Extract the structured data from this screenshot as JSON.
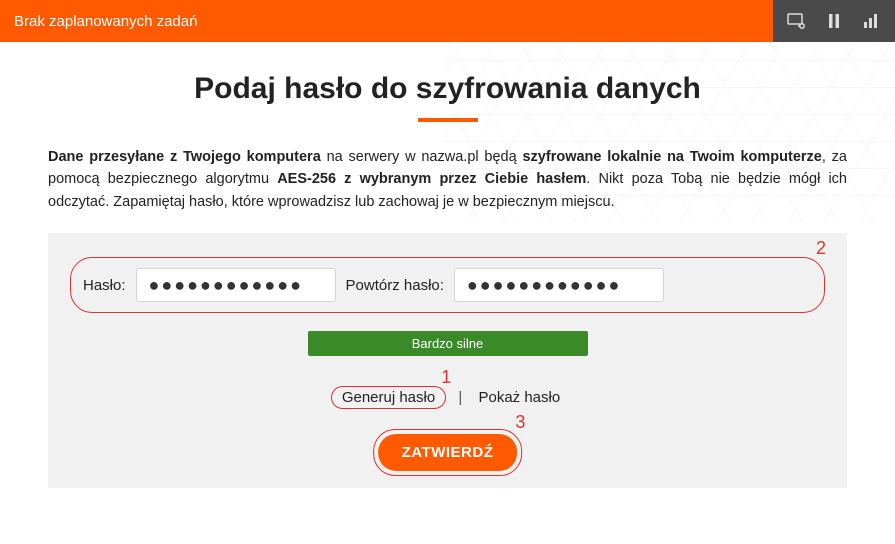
{
  "topbar": {
    "status": "Brak zaplanowanych zadań"
  },
  "heading": "Podaj hasło do szyfrowania danych",
  "description": {
    "part1_bold": "Dane przesyłane z Twojego komputera",
    "part2": " na serwery w nazwa.pl będą ",
    "part3_bold": "szyfrowane lokalnie na Twoim komputerze",
    "part4": ", za pomocą bezpiecznego algorytmu ",
    "part5_bold": "AES-256 z wybranym przez Ciebie hasłem",
    "part6": ". Nikt poza Tobą nie będzie mógł ich odczytać. Zapamiętaj hasło, które wprowadzisz lub zachowaj je w bezpiecznym miejscu."
  },
  "form": {
    "password_label": "Hasło:",
    "password_value": "●●●●●●●●●●●●",
    "repeat_label": "Powtórz hasło:",
    "repeat_value": "●●●●●●●●●●●●",
    "strength": "Bardzo silne",
    "generate": "Generuj hasło",
    "show": "Pokaż hasło",
    "submit": "ZATWIERDŹ"
  },
  "callouts": {
    "c1": "1",
    "c2": "2",
    "c3": "3"
  }
}
